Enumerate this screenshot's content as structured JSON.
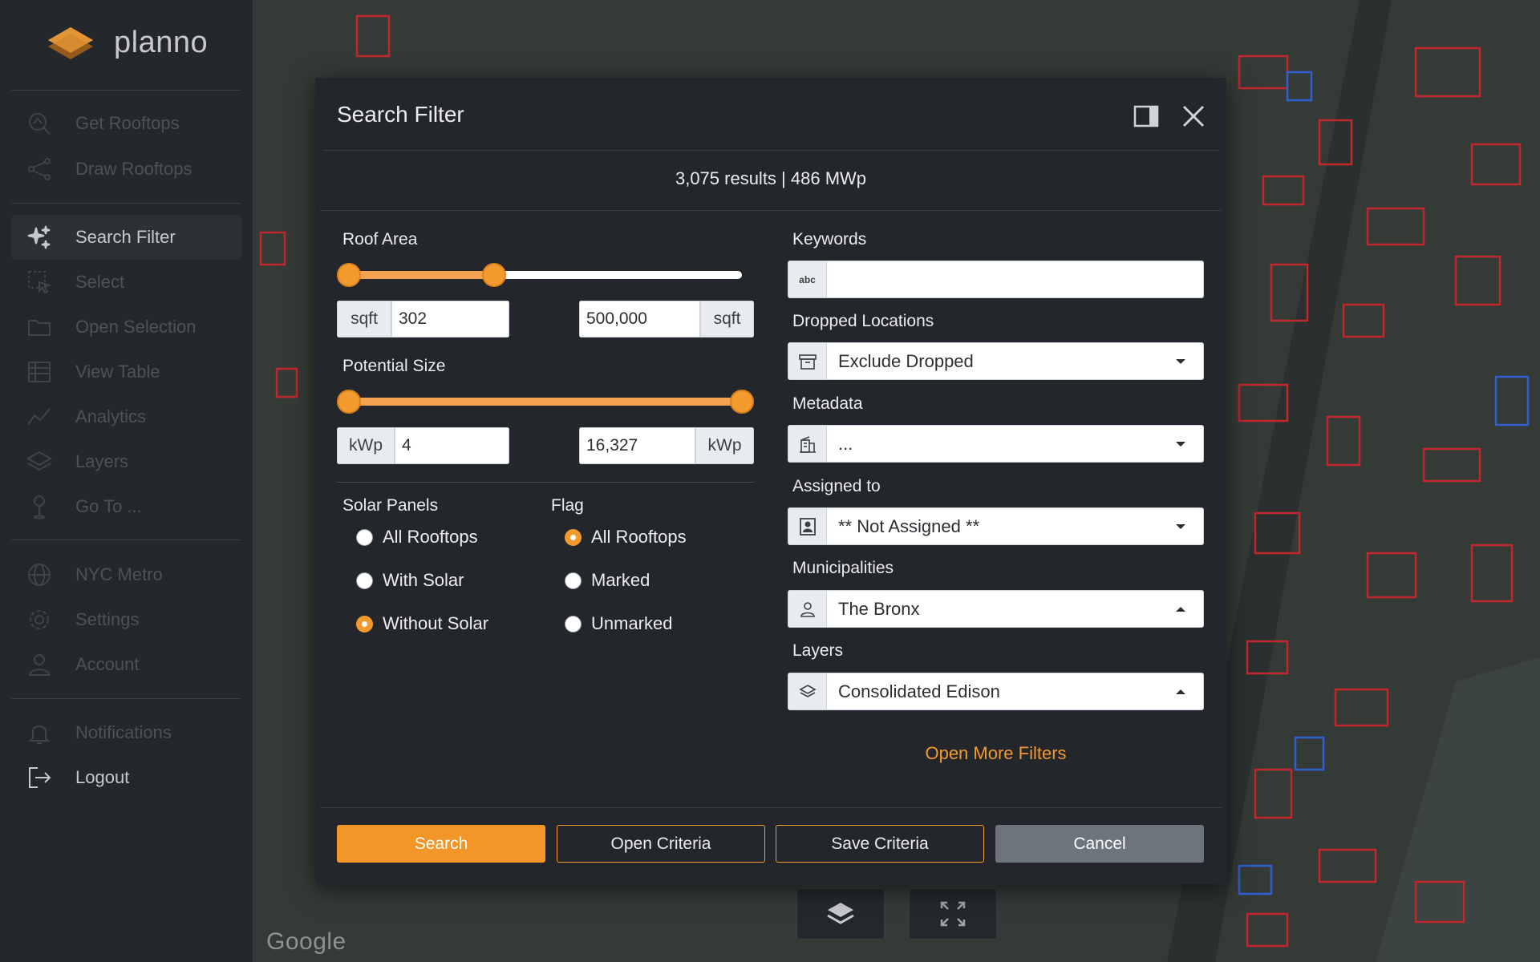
{
  "app": {
    "name": "planno"
  },
  "sidebar": {
    "items": [
      {
        "label": "Get Rooftops",
        "icon": "search-rooftop-icon"
      },
      {
        "label": "Draw Rooftops",
        "icon": "draw-icon"
      },
      {
        "label": "Search Filter",
        "icon": "sparkle-icon",
        "active": true
      },
      {
        "label": "Select",
        "icon": "select-icon"
      },
      {
        "label": "Open Selection",
        "icon": "folder-icon"
      },
      {
        "label": "View Table",
        "icon": "table-icon"
      },
      {
        "label": "Analytics",
        "icon": "analytics-icon"
      },
      {
        "label": "Layers",
        "icon": "layers-icon"
      },
      {
        "label": "Go To ...",
        "icon": "pin-icon"
      },
      {
        "label": "NYC Metro",
        "icon": "globe-icon"
      },
      {
        "label": "Settings",
        "icon": "gear-icon"
      },
      {
        "label": "Account",
        "icon": "user-icon"
      },
      {
        "label": "Notifications",
        "icon": "bell-icon"
      },
      {
        "label": "Logout",
        "icon": "logout-icon"
      }
    ]
  },
  "map": {
    "attribution": "Google"
  },
  "modal": {
    "title": "Search Filter",
    "results": "3,075 results | 486 MWp",
    "roof_area": {
      "label": "Roof Area",
      "unit": "sqft",
      "min_value": "302",
      "max_value": "500,000",
      "slider_low_pct": 0,
      "slider_high_pct": 37
    },
    "potential_size": {
      "label": "Potential Size",
      "unit": "kWp",
      "min_value": "4",
      "max_value": "16,327",
      "slider_low_pct": 0,
      "slider_high_pct": 100
    },
    "solar_panels": {
      "label": "Solar Panels",
      "options": [
        "All Rooftops",
        "With Solar",
        "Without Solar"
      ],
      "selected": "Without Solar"
    },
    "flag": {
      "label": "Flag",
      "options": [
        "All Rooftops",
        "Marked",
        "Unmarked"
      ],
      "selected": "All Rooftops"
    },
    "keywords": {
      "label": "Keywords",
      "icon_text": "abc",
      "value": ""
    },
    "dropped_locations": {
      "label": "Dropped Locations",
      "value": "Exclude Dropped"
    },
    "metadata": {
      "label": "Metadata",
      "value": "..."
    },
    "assigned_to": {
      "label": "Assigned to",
      "value": "** Not Assigned **"
    },
    "municipalities": {
      "label": "Municipalities",
      "value": "The Bronx"
    },
    "layers": {
      "label": "Layers",
      "value": "Consolidated Edison"
    },
    "more_filters": "Open More Filters",
    "buttons": {
      "search": "Search",
      "open_criteria": "Open Criteria",
      "save_criteria": "Save Criteria",
      "cancel": "Cancel"
    }
  },
  "colors": {
    "accent": "#f29a2e",
    "modal_bg": "#23262b",
    "sidebar_bg": "#24272b",
    "rooftop_outline": "#c1272d",
    "selected_outline": "#2f5fd0"
  }
}
